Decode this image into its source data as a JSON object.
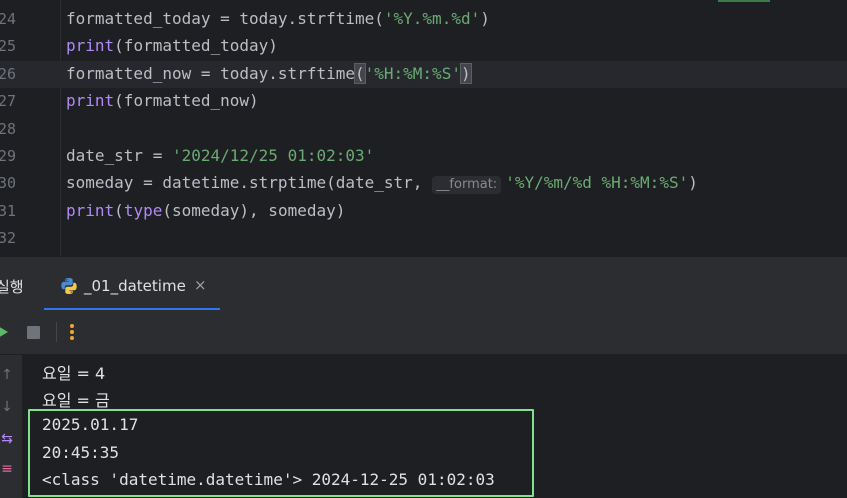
{
  "editor": {
    "lines": [
      {
        "num": "24",
        "parts": [
          [
            "plain",
            "formatted_today = today.strftime("
          ],
          [
            "str",
            "'%Y.%m.%d'"
          ],
          [
            "plain",
            ")"
          ]
        ]
      },
      {
        "num": "25",
        "parts": [
          [
            "fn",
            "print"
          ],
          [
            "plain",
            "(formatted_today)"
          ]
        ]
      },
      {
        "num": "26",
        "current": true,
        "parts": [
          [
            "plain",
            "formatted_now = today.strftime"
          ],
          [
            "brhl",
            "("
          ],
          [
            "str",
            "'%H:%M:%S'"
          ],
          [
            "brhl",
            ")"
          ]
        ]
      },
      {
        "num": "27",
        "parts": [
          [
            "fn",
            "print"
          ],
          [
            "plain",
            "(formatted_now)"
          ]
        ]
      },
      {
        "num": "28",
        "parts": []
      },
      {
        "num": "29",
        "parts": [
          [
            "plain",
            "date_str = "
          ],
          [
            "str",
            "'2024/12/25 01:02:03'"
          ]
        ]
      },
      {
        "num": "30",
        "parts": [
          [
            "plain",
            "someday = datetime.strptime(date_str,"
          ],
          [
            "hint",
            "__format:"
          ],
          [
            "str",
            "'%Y/%m/%d %H:%M:%S'"
          ],
          [
            "plain",
            ")"
          ]
        ]
      },
      {
        "num": "31",
        "parts": [
          [
            "fn",
            "print"
          ],
          [
            "plain",
            "("
          ],
          [
            "fn",
            "type"
          ],
          [
            "plain",
            "(someday), someday)"
          ]
        ]
      },
      {
        "num": "32",
        "parts": []
      }
    ]
  },
  "run_panel": {
    "label": "실행",
    "tab_label": "_01_datetime",
    "tab_close": "×"
  },
  "toolbar": {
    "rerun_icon": "rerun-icon",
    "stop_icon": "stop-icon",
    "more_icon": "more-options-icon"
  },
  "console": {
    "lines": [
      "요일 = 4",
      "요일 = 금",
      "2025.01.17",
      "20:45:35",
      "<class 'datetime.datetime'> 2024-12-25 01:02:03"
    ]
  },
  "colors": {
    "string": "#6aab73",
    "builtin": "#b189f5",
    "highlight_box": "#7ee38a",
    "tab_underline": "#3574f0"
  }
}
